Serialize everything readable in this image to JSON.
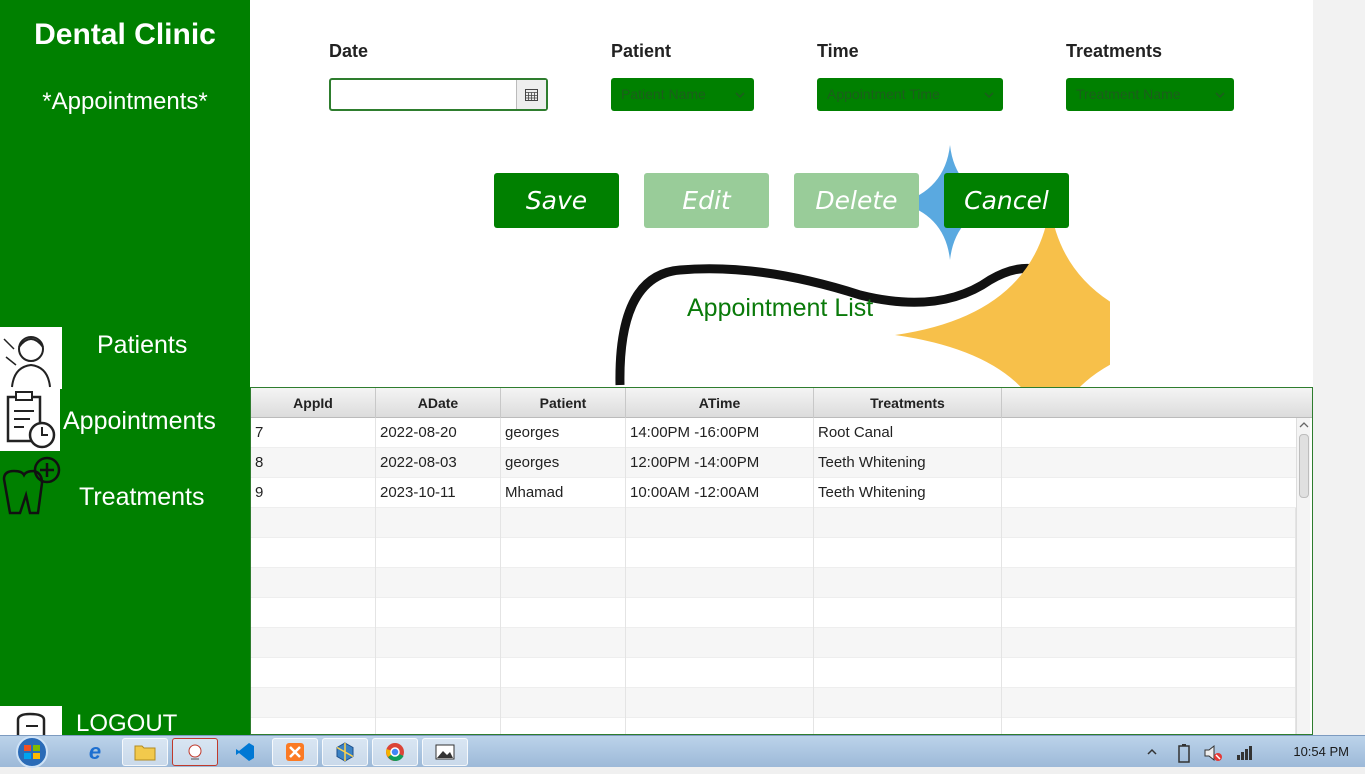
{
  "sidebar": {
    "brand": "Dental Clinic",
    "section": "*Appointments*",
    "nav": [
      {
        "label": "Patients",
        "icon": "patient-icon"
      },
      {
        "label": "Appointments",
        "icon": "clipboard-clock-icon"
      },
      {
        "label": "Treatments",
        "icon": "tooth-plus-icon"
      }
    ],
    "logout_label": "LOGOUT",
    "bg_color": "#008000"
  },
  "form": {
    "date_label": "Date",
    "date_value": "",
    "patient_label": "Patient",
    "patient_placeholder": "Patient Name",
    "time_label": "Time",
    "time_placeholder": "Appointment Time",
    "treatments_label": "Treatments",
    "treatment_placeholder": "Treatment Name"
  },
  "buttons": {
    "save": "Save",
    "edit": "Edit",
    "delete": "Delete",
    "cancel": "Cancel"
  },
  "list": {
    "title": "Appointment List",
    "columns": [
      "AppId",
      "ADate",
      "Patient",
      "ATime",
      "Treatments"
    ],
    "rows": [
      [
        "7",
        "2022-08-20",
        "georges",
        "14:00PM -16:00PM",
        "Root Canal"
      ],
      [
        "8",
        "2022-08-03",
        "georges",
        "12:00PM -14:00PM",
        "Teeth Whitening"
      ],
      [
        "9",
        "2023-10-11",
        "Mhamad",
        "10:00AM -12:00AM",
        "Teeth Whitening"
      ]
    ]
  },
  "taskbar": {
    "apps": [
      "start-orb-icon",
      "internet-explorer-icon",
      "file-explorer-icon",
      "java-app-icon",
      "vscode-icon",
      "xampp-icon",
      "box-app-icon",
      "chrome-icon",
      "photo-app-icon"
    ],
    "time": "10:54 PM"
  }
}
